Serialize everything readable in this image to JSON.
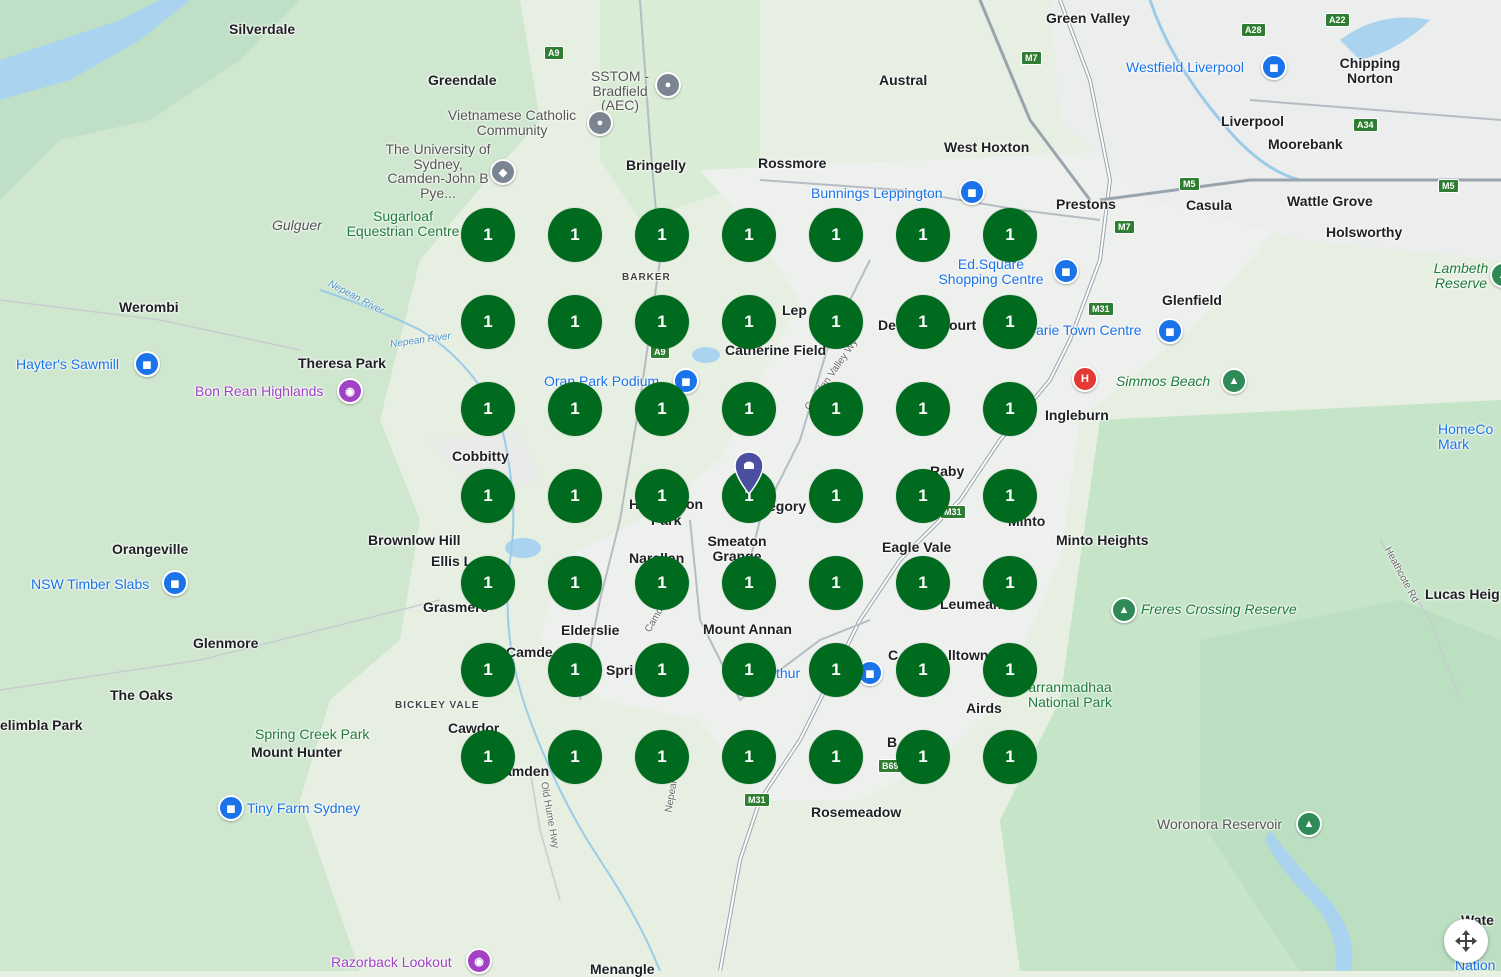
{
  "colors": {
    "cluster": "#006b1f",
    "marker": "#4a4fa0",
    "park": "#c8e6c9",
    "urban": "#f1f3f4"
  },
  "labels": {
    "silverdale": "Silverdale",
    "greendale": "Greendale",
    "green_valley": "Green Valley",
    "austral": "Austral",
    "westfield_liverpool": "Westfield Liverpool",
    "chipping_norton": "Chipping Norton",
    "liverpool": "Liverpool",
    "moorebank": "Moorebank",
    "sstom": "SSTOM - Bradfield (AEC)",
    "vietnamese": "Vietnamese Catholic Community",
    "university": "The University of Sydney, Camden-John B Pye...",
    "bringelly": "Bringelly",
    "rossmore": "Rossmore",
    "west_hoxton": "West Hoxton",
    "bunnings": "Bunnings Leppington",
    "prestons": "Prestons",
    "casula": "Casula",
    "wattle_grove": "Wattle Grove",
    "holsworthy": "Holsworthy",
    "gulguer": "Gulguer",
    "sugarloaf": "Sugarloaf Equestrian Centre",
    "barker": "BARKER",
    "edsquare": "Ed.Square Shopping Centre",
    "lambeth": "Lambeth Reserve",
    "werombi": "Werombi",
    "nepean1": "Nepean River",
    "nepean2": "Nepean River",
    "lep": "Lep",
    "de": "De",
    "ourt": "ourt",
    "glenfield": "Glenfield",
    "catherine_field": "Catherine Field",
    "arie_town": "arie Town Centre",
    "hayters": "Hayter's Sawmill",
    "theresa_park": "Theresa Park",
    "bon_rean": "Bon Rean Highlands",
    "oran_park": "Oran Park Podium",
    "simmos": "Simmos Beach",
    "ingleburn": "Ingleburn",
    "homeco": "HomeCo Mark",
    "cobbitty": "Cobbitty",
    "raby": "Raby",
    "h_on": "H",
    "on": "on",
    "park": "Park",
    "gregory": "egory",
    "minto": "Minto",
    "orangeville": "Orangeville",
    "brownlow_hill": "Brownlow Hill",
    "ellis": "Ellis L",
    "smeaton": "Smeaton Grange",
    "narellan": "Narellan",
    "eagle_vale": "Eagle Vale",
    "minto_heights": "Minto Heights",
    "nsw_timber": "NSW Timber Slabs",
    "grasmere": "Grasmere",
    "elderslie": "Elderslie",
    "leumeah": "Leumeah",
    "freres": "Freres Crossing Reserve",
    "lucas": "Lucas Heig",
    "glenmore": "Glenmore",
    "camden": "Camde",
    "spri": "Spri",
    "mount_annan": "Mount Annan",
    "c_": "C",
    "lltown": "lltown",
    "dharawal": "arranmadhaa National Park",
    "the_oaks": "The Oaks",
    "bickley": "BICKLEY VALE",
    "thur": "thur",
    "airds": "Airds",
    "elimbla": "elimbla Park",
    "spring_creek": "Spring Creek Park",
    "mount_hunter": "Mount Hunter",
    "cawdor": "Cawdor",
    "camden2": "amden",
    "b_": "B",
    "tiny_farm": "Tiny Farm Sydney",
    "rosemeadow": "Rosemeadow",
    "woronora": "Woronora Reservoir",
    "razorback": "Razorback Lookout",
    "menangle": "Menangle",
    "water": "Wate",
    "nation": "Nation",
    "heathcote_rd": "Heathcote Rd",
    "old_hume": "Old Hume Hwy",
    "camden_bypass": "Camden Bypass",
    "camden_valley": "Camden Valley Wy",
    "nepean_label": "Nepean"
  },
  "shields": {
    "a9_top": "A9",
    "a28": "A28",
    "a22": "A22",
    "m7_top": "M7",
    "a34": "A34",
    "m5_left": "M5",
    "m5_right": "M5",
    "m7_mid": "M7",
    "m31_top": "M31",
    "a9_mid": "A9",
    "m31_mid": "M31",
    "b69": "B69",
    "m31_bot": "M31"
  },
  "icons": {
    "hospital": "H"
  },
  "clusters": [
    "1",
    "1",
    "1",
    "1",
    "1",
    "1",
    "1",
    "1",
    "1",
    "1",
    "1",
    "1",
    "1",
    "1",
    "1",
    "1",
    "1",
    "1",
    "1",
    "1",
    "1",
    "1",
    "1",
    "1",
    "1",
    "1",
    "1",
    "1",
    "1",
    "1",
    "1",
    "1",
    "1",
    "1",
    "1",
    "1",
    "1",
    "1",
    "1",
    "1",
    "1",
    "1",
    "1",
    "1",
    "1",
    "1",
    "1",
    "1",
    "1"
  ]
}
